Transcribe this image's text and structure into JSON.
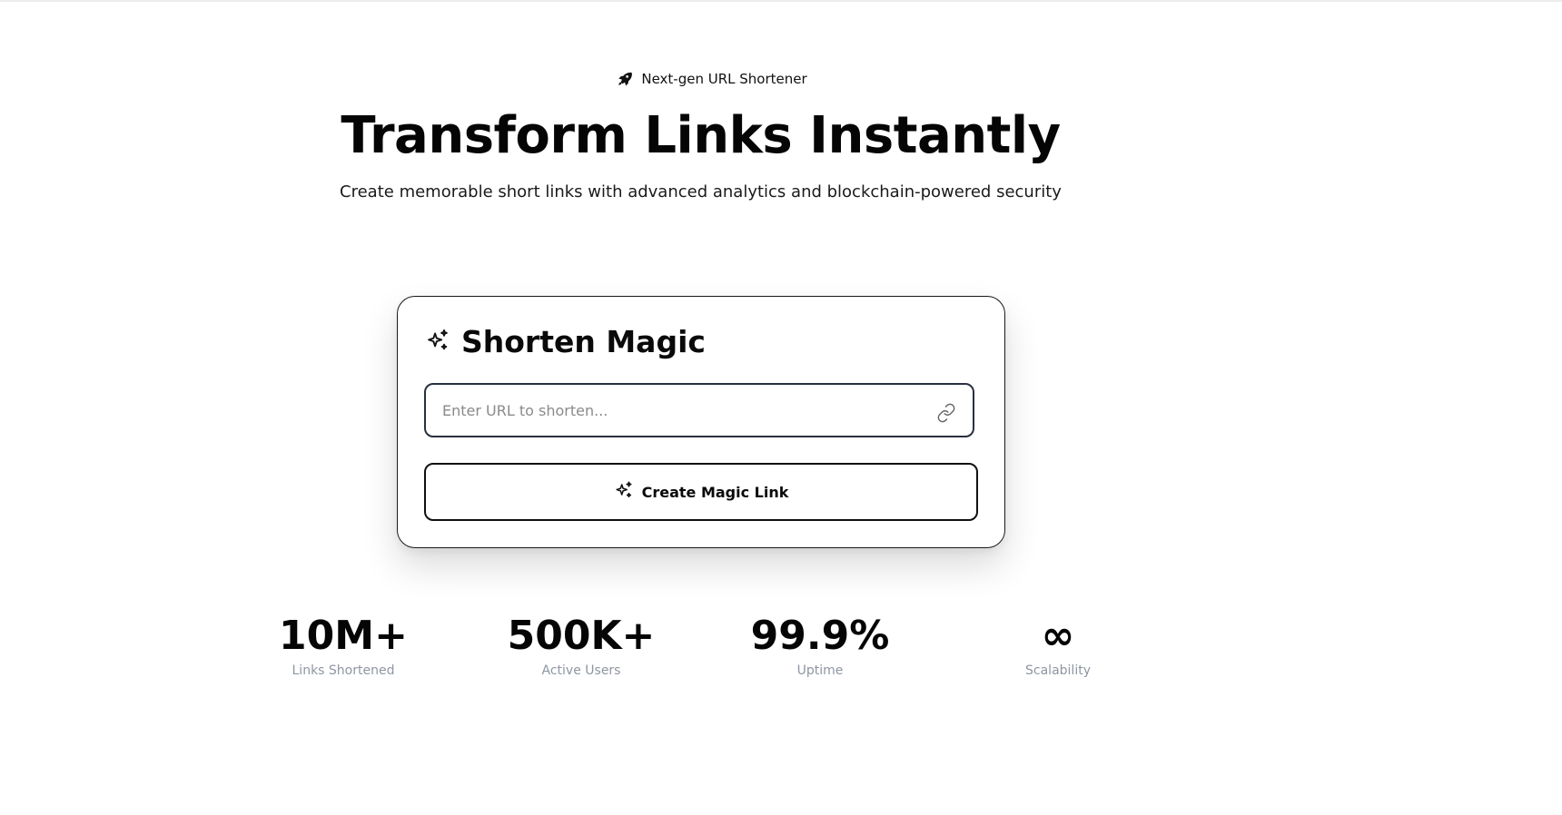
{
  "hero": {
    "badge": "Next-gen URL Shortener",
    "badge_icon": "rocket-icon",
    "title": "Transform Links Instantly",
    "subtitle": "Create memorable short links with advanced analytics and blockchain-powered security"
  },
  "card": {
    "title": "Shorten Magic",
    "title_icon": "sparkles-icon",
    "input": {
      "placeholder": "Enter URL to shorten...",
      "value": "",
      "icon": "link-icon"
    },
    "button": {
      "label": "Create Magic Link",
      "icon": "sparkles-icon"
    }
  },
  "stats": [
    {
      "value": "10M+",
      "label": "Links Shortened"
    },
    {
      "value": "500K+",
      "label": "Active Users"
    },
    {
      "value": "99.9%",
      "label": "Uptime"
    },
    {
      "value": "∞",
      "label": "Scalability"
    }
  ],
  "colors": {
    "text": "#0a0a0a",
    "muted": "#8e96a3",
    "border": "#1a1a1a",
    "input_border": "#2a3040"
  }
}
